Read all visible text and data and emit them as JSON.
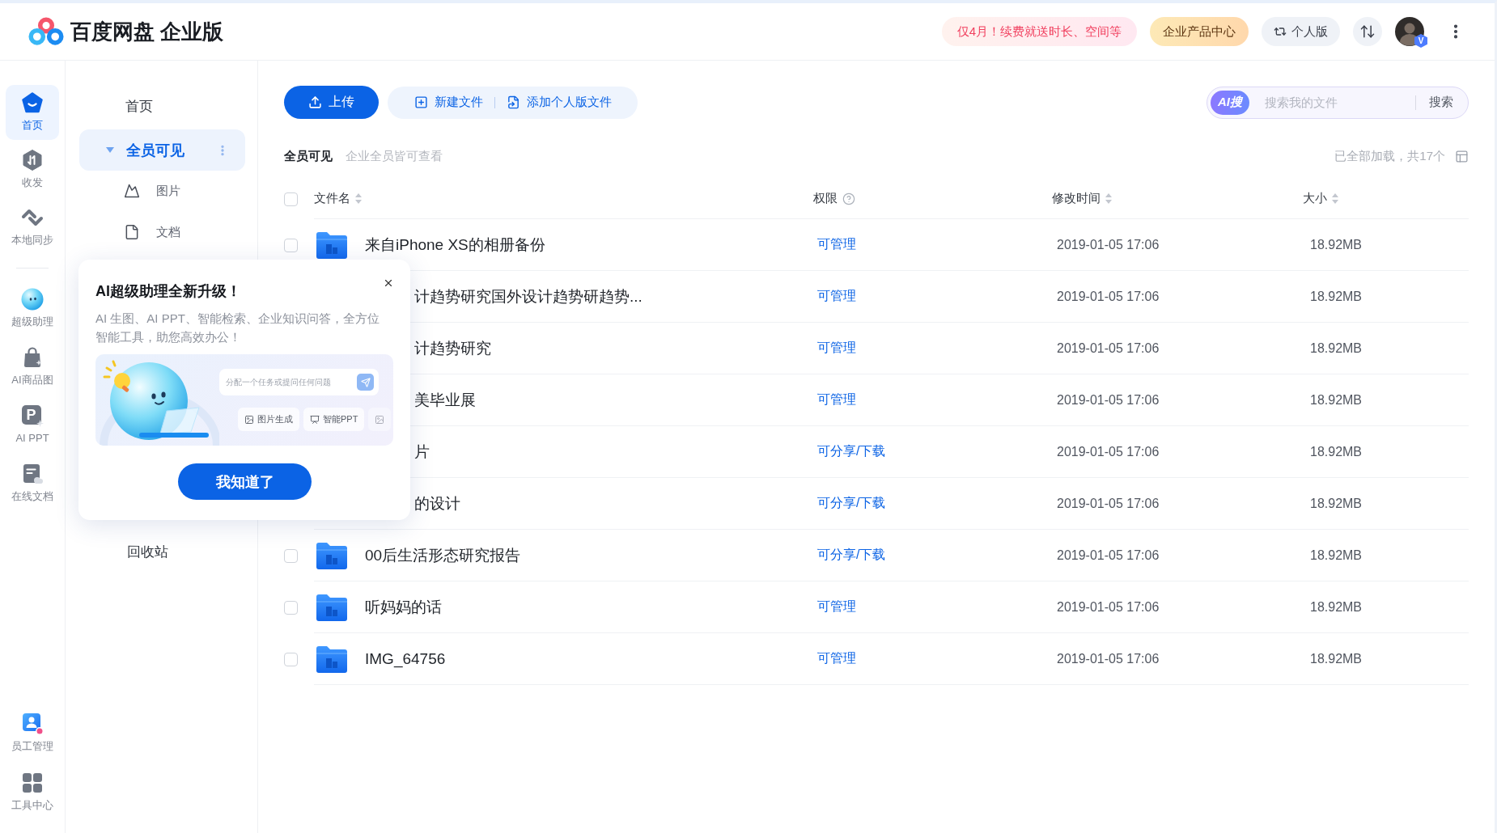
{
  "header": {
    "title": "百度网盘 企业版",
    "promo": "仅4月！续费就送时长、空间等",
    "product_center": "企业产品中心",
    "personal": "个人版",
    "avatar_badge": "V"
  },
  "rail": {
    "top": [
      {
        "label": "首页",
        "selected": true
      },
      {
        "label": "收发",
        "selected": false
      },
      {
        "label": "本地同步",
        "selected": false
      }
    ],
    "tools": [
      {
        "label": "超级助理",
        "selected": false
      },
      {
        "label": "AI商品图",
        "selected": false
      },
      {
        "label": "AI PPT",
        "selected": false,
        "icon_letter": "P"
      },
      {
        "label": "在线文档",
        "selected": false
      }
    ],
    "bottom": [
      {
        "label": "员工管理",
        "selected": false
      },
      {
        "label": "工具中心",
        "selected": false
      }
    ]
  },
  "sidebar": {
    "items": [
      {
        "label": "首页",
        "selected": false
      },
      {
        "label": "全员可见",
        "selected": true,
        "expanded": true,
        "children": [
          {
            "label": "图片",
            "selected": false
          },
          {
            "label": "文档",
            "selected": false
          }
        ]
      }
    ],
    "trash": {
      "label": "回收站",
      "selected": false
    }
  },
  "toolbar": {
    "upload": "上传",
    "actions": [
      "新建文件",
      "添加个人版文件"
    ],
    "search": {
      "badge": "AI搜",
      "placeholder": "搜索我的文件",
      "button": "搜索"
    }
  },
  "breadcrumb": {
    "title": "全员可见",
    "subtitle": "企业全员皆可查看",
    "summary": "已全部加载，共17个"
  },
  "table": {
    "select_all": {
      "checked": false
    },
    "columns": [
      {
        "label": "文件名",
        "kind": "sortable"
      },
      {
        "label": "权限",
        "kind": "help"
      },
      {
        "label": "修改时间",
        "kind": "sortable"
      },
      {
        "label": "大小",
        "kind": "sortable"
      }
    ],
    "rows": [
      {
        "kind": "file",
        "checked": false,
        "name": "来自iPhone XS的相册备份",
        "permission": "可管理",
        "modified": "2019-01-05 17:06",
        "size": "18.92MB"
      },
      {
        "kind": "covered",
        "name": "计趋势研究国外设计趋势研趋势...",
        "permission": "可管理",
        "modified": "2019-01-05 17:06",
        "size": "18.92MB"
      },
      {
        "kind": "covered",
        "name": "计趋势研究",
        "permission": "可管理",
        "modified": "2019-01-05 17:06",
        "size": "18.92MB"
      },
      {
        "kind": "covered",
        "name": "美毕业展",
        "permission": "可管理",
        "modified": "2019-01-05 17:06",
        "size": "18.92MB"
      },
      {
        "kind": "covered",
        "name": "片",
        "permission": "可分享/下载",
        "modified": "2019-01-05 17:06",
        "size": "18.92MB"
      },
      {
        "kind": "covered",
        "name": "的设计",
        "permission": "可分享/下载",
        "modified": "2019-01-05 17:06",
        "size": "18.92MB"
      },
      {
        "kind": "file",
        "checked": false,
        "name": "00后生活形态研究报告",
        "permission": "可分享/下载",
        "modified": "2019-01-05 17:06",
        "size": "18.92MB"
      },
      {
        "kind": "file",
        "checked": false,
        "name": "听妈妈的话",
        "permission": "可管理",
        "modified": "2019-01-05 17:06",
        "size": "18.92MB"
      },
      {
        "kind": "file",
        "checked": false,
        "name": "IMG_64756",
        "permission": "可管理",
        "modified": "2019-01-05 17:06",
        "size": "18.92MB"
      }
    ]
  },
  "popup": {
    "title": "AI超级助理全新升级！",
    "description": "AI 生图、AI PPT、智能检索、企业知识问答，全方位智能工具，助您高效办公！",
    "illustration": {
      "prompt_placeholder": "分配一个任务或提问任何问题",
      "chips": [
        "图片生成",
        "智能PPT"
      ]
    },
    "button": "我知道了"
  }
}
